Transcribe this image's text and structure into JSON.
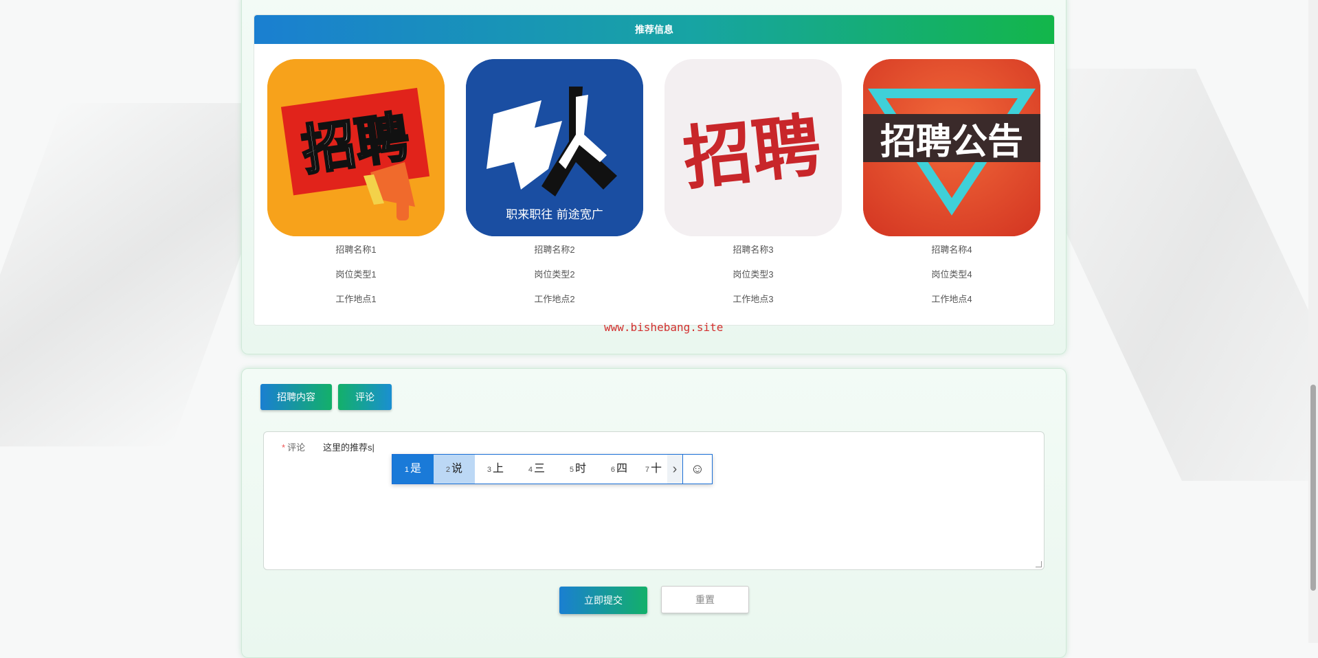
{
  "recommend": {
    "title": "推荐信息",
    "items": [
      {
        "image_text": "招聘",
        "name": "招聘名称1",
        "type": "岗位类型1",
        "location": "工作地点1"
      },
      {
        "image_text": "职来职往 前途宽广",
        "name": "招聘名称2",
        "type": "岗位类型2",
        "location": "工作地点2"
      },
      {
        "image_text": "招聘",
        "name": "招聘名称3",
        "type": "岗位类型3",
        "location": "工作地点3"
      },
      {
        "image_text": "招聘公告",
        "name": "招聘名称4",
        "type": "岗位类型4",
        "location": "工作地点4"
      }
    ]
  },
  "watermark": "www.bishebang.site",
  "tabs": [
    "招聘内容",
    "评论"
  ],
  "comment_form": {
    "label": "评论",
    "required_mark": "*",
    "value": "这里的推荐s|"
  },
  "ime": {
    "candidates": [
      {
        "n": "1",
        "w": "是"
      },
      {
        "n": "2",
        "w": "说"
      },
      {
        "n": "3",
        "w": "上"
      },
      {
        "n": "4",
        "w": "三"
      },
      {
        "n": "5",
        "w": "时"
      },
      {
        "n": "6",
        "w": "四"
      },
      {
        "n": "7",
        "w": "十"
      }
    ],
    "next": "›",
    "emoji": "☺"
  },
  "buttons": {
    "submit": "立即提交",
    "reset": "重置"
  }
}
